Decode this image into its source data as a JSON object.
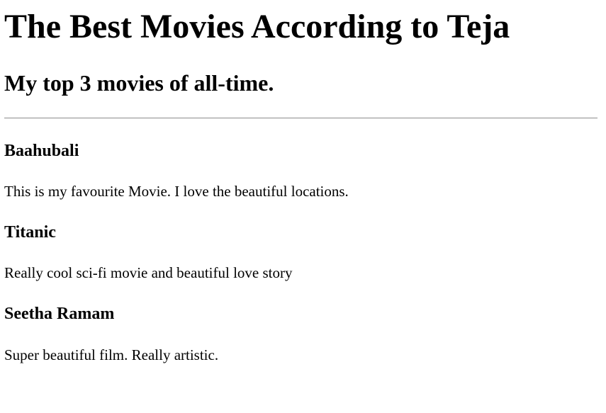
{
  "header": {
    "title": "The Best Movies According to Teja",
    "subtitle": "My top 3 movies of all-time."
  },
  "movies": [
    {
      "title": "Baahubali",
      "description": "This is my favourite Movie. I love the beautiful locations."
    },
    {
      "title": "Titanic",
      "description": "Really cool sci-fi movie and beautiful love story"
    },
    {
      "title": "Seetha Ramam",
      "description": "Super beautiful film. Really artistic."
    }
  ]
}
